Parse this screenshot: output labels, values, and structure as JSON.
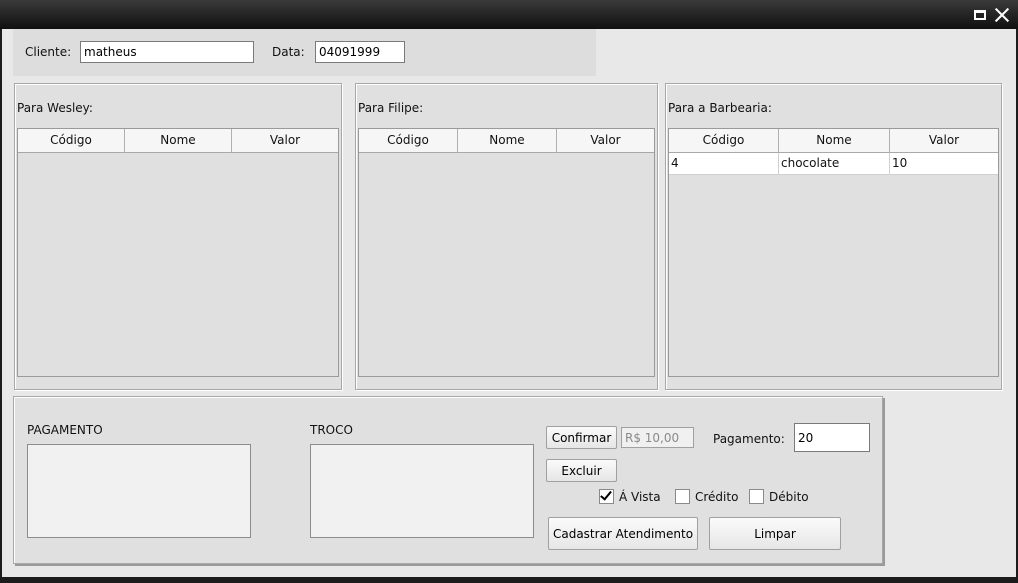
{
  "header": {
    "cliente_label": "Cliente:",
    "cliente_value": "matheus",
    "data_label": "Data:",
    "data_value": "04091999"
  },
  "tables": {
    "wesley": {
      "title": "Para Wesley:",
      "columns": [
        "Código",
        "Nome",
        "Valor"
      ],
      "rows": []
    },
    "filipe": {
      "title": "Para Filipe:",
      "columns": [
        "Código",
        "Nome",
        "Valor"
      ],
      "rows": []
    },
    "barbearia": {
      "title": "Para a Barbearia:",
      "columns": [
        "Código",
        "Nome",
        "Valor"
      ],
      "rows": [
        [
          "4",
          "chocolate",
          "10"
        ]
      ]
    }
  },
  "payment": {
    "pagamento_title": "PAGAMENTO",
    "troco_title": "TROCO",
    "confirmar_label": "Confirmar",
    "valor_field": "R$ 10,00",
    "pagamento_label": "Pagamento:",
    "pagamento_value": "20",
    "excluir_label": "Excluir",
    "options": [
      {
        "label": "Á Vista",
        "checked": true
      },
      {
        "label": "Crédito",
        "checked": false
      },
      {
        "label": "Débito",
        "checked": false
      }
    ],
    "cadastrar_label": "Cadastrar Atendimento",
    "limpar_label": "Limpar"
  }
}
